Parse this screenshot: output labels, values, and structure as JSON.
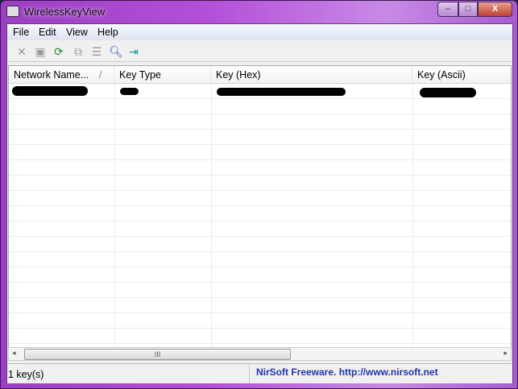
{
  "window": {
    "title": "WirelessKeyView",
    "minimize": "–",
    "maximize": "□",
    "close": "X"
  },
  "menu": [
    "File",
    "Edit",
    "View",
    "Help"
  ],
  "toolbar": [
    "delete-icon",
    "save-icon",
    "refresh-icon",
    "copy-icon",
    "properties-icon",
    "search-icon",
    "exit-icon"
  ],
  "columns": [
    {
      "label": "Network Name...",
      "sort": "/"
    },
    {
      "label": "Key Type"
    },
    {
      "label": "Key (Hex)"
    },
    {
      "label": "Key (Ascii)"
    }
  ],
  "scrollbar": {
    "grip": "III",
    "left": "◂",
    "right": "▸"
  },
  "status": {
    "count": "1 key(s)",
    "credit": "NirSoft Freeware.  http://www.nirsoft.net"
  }
}
